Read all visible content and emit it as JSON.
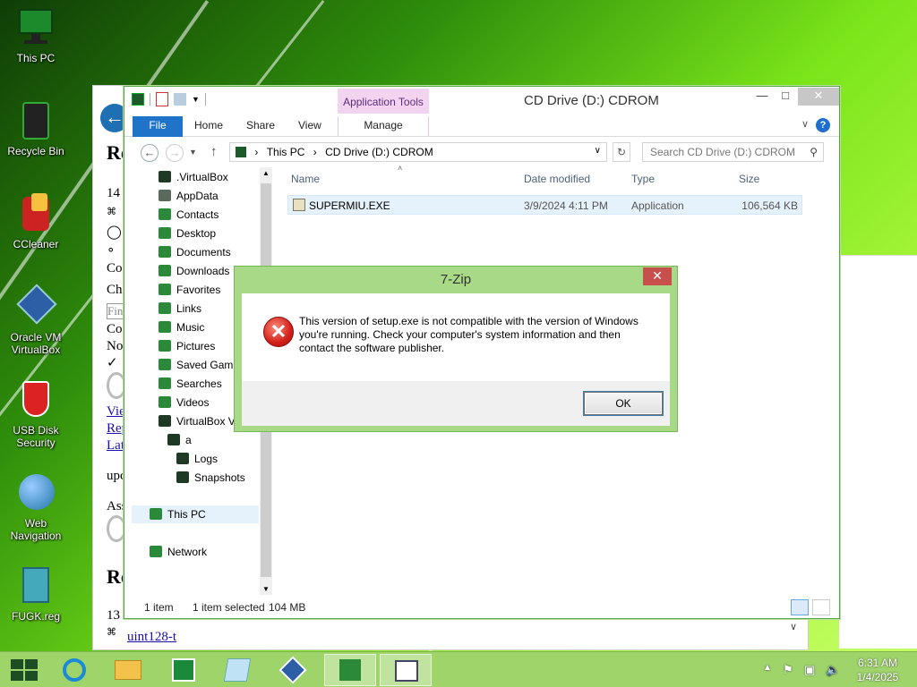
{
  "desktop": {
    "icons": [
      {
        "label": "This PC"
      },
      {
        "label": "Recycle Bin"
      },
      {
        "label": "CCleaner"
      },
      {
        "label": "Oracle VM VirtualBox"
      },
      {
        "label": "USB Disk Security"
      },
      {
        "label": "Web Navigation"
      },
      {
        "label": "FUGK.reg"
      }
    ]
  },
  "background_window": {
    "lines": [
      "Ro",
      "14",
      "⌘",
      "∘",
      "Co",
      "Ch",
      "Fin",
      "Co",
      "No",
      "✓",
      "Vie",
      "Rep",
      "Lat",
      "upc",
      "Ass",
      "Ro",
      "13"
    ],
    "bottom_link": "uint128-t"
  },
  "explorer": {
    "title": "CD Drive (D:) CDROM",
    "app_tools": "Application Tools",
    "tabs": {
      "file": "File",
      "home": "Home",
      "share": "Share",
      "view": "View",
      "manage": "Manage"
    },
    "address": {
      "this_pc": "This PC",
      "sep": "›",
      "drive": "CD Drive (D:) CDROM"
    },
    "search_placeholder": "Search CD Drive (D:) CDROM",
    "nav_items": [
      ".VirtualBox",
      "AppData",
      "Contacts",
      "Desktop",
      "Documents",
      "Downloads",
      "Favorites",
      "Links",
      "Music",
      "Pictures",
      "Saved Game",
      "Searches",
      "Videos",
      "VirtualBox V",
      "a",
      "Logs",
      "Snapshots"
    ],
    "nav_this_pc": "This PC",
    "nav_network": "Network",
    "columns": {
      "name": "Name",
      "date": "Date modified",
      "type": "Type",
      "size": "Size"
    },
    "file": {
      "name": "SUPERMIU.EXE",
      "date": "3/9/2024 4:11 PM",
      "type": "Application",
      "size": "106,564 KB"
    },
    "status": {
      "items": "1 item",
      "selected": "1 item selected",
      "size": "104 MB"
    }
  },
  "dialog": {
    "title": "7-Zip",
    "close": "✕",
    "message": "This version of setup.exe is not compatible with the version of Windows you're running. Check your computer's system information and then contact the software publisher.",
    "ok": "OK"
  },
  "taskbar": {
    "time": "6:31 AM",
    "date": "1/4/2025"
  },
  "colors": {
    "accent": "#1f73c9",
    "close_red": "#c7504d",
    "taskbar": "#9ed46a"
  }
}
